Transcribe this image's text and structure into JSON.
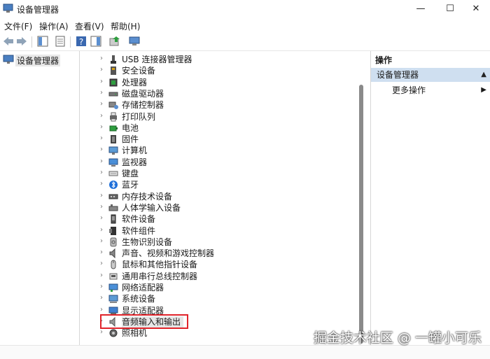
{
  "window": {
    "title": "设备管理器",
    "minimize_glyph": "—",
    "maximize_glyph": "☐",
    "close_glyph": "✕"
  },
  "menu": [
    "文件(F)",
    "操作(A)",
    "查看(V)",
    "帮助(H)"
  ],
  "left_pane": {
    "root_label": "设备管理器"
  },
  "devices": [
    {
      "label": "USB 连接器管理器",
      "icon": "usb-icon"
    },
    {
      "label": "安全设备",
      "icon": "security-device-icon"
    },
    {
      "label": "处理器",
      "icon": "processor-icon"
    },
    {
      "label": "磁盘驱动器",
      "icon": "disk-drive-icon"
    },
    {
      "label": "存储控制器",
      "icon": "storage-controller-icon"
    },
    {
      "label": "打印队列",
      "icon": "printer-icon"
    },
    {
      "label": "电池",
      "icon": "battery-icon"
    },
    {
      "label": "固件",
      "icon": "firmware-icon"
    },
    {
      "label": "计算机",
      "icon": "computer-icon"
    },
    {
      "label": "监视器",
      "icon": "monitor-icon"
    },
    {
      "label": "键盘",
      "icon": "keyboard-icon"
    },
    {
      "label": "蓝牙",
      "icon": "bluetooth-icon"
    },
    {
      "label": "内存技术设备",
      "icon": "memory-icon"
    },
    {
      "label": "人体学输入设备",
      "icon": "hid-icon"
    },
    {
      "label": "软件设备",
      "icon": "software-device-icon"
    },
    {
      "label": "软件组件",
      "icon": "software-component-icon"
    },
    {
      "label": "生物识别设备",
      "icon": "biometric-icon"
    },
    {
      "label": "声音、视频和游戏控制器",
      "icon": "sound-icon"
    },
    {
      "label": "鼠标和其他指针设备",
      "icon": "mouse-icon"
    },
    {
      "label": "通用串行总线控制器",
      "icon": "usb-controller-icon"
    },
    {
      "label": "网络适配器",
      "icon": "network-adapter-icon"
    },
    {
      "label": "系统设备",
      "icon": "system-device-icon"
    },
    {
      "label": "显示适配器",
      "icon": "display-adapter-icon"
    },
    {
      "label": "音频输入和输出",
      "icon": "audio-io-icon"
    },
    {
      "label": "照相机",
      "icon": "camera-icon"
    }
  ],
  "actions": {
    "header": "操作",
    "section": "设备管理器",
    "more": "更多操作"
  },
  "watermark": "掘金技术社区 @ 一罐小可乐",
  "colors": {
    "highlight_border": "#e0242b",
    "action_section_bg": "#cfdff0"
  }
}
